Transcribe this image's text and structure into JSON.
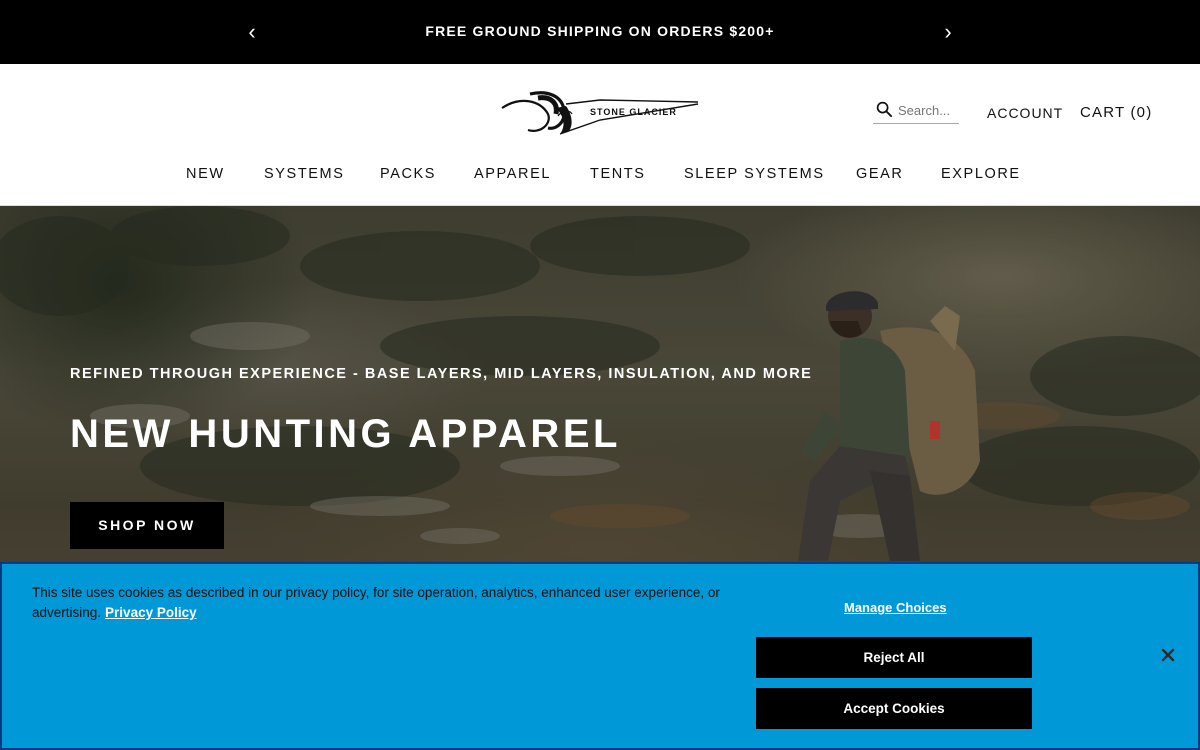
{
  "announcement": {
    "message": "FREE GROUND SHIPPING ON ORDERS $200+",
    "prev_arrow": "‹",
    "next_arrow": "›"
  },
  "header": {
    "logo_text": "STONE GLACIER",
    "search": {
      "placeholder": "Search..."
    },
    "account_label": "ACCOUNT",
    "cart_label": "CART (0)"
  },
  "nav": {
    "items": [
      {
        "label": "NEW"
      },
      {
        "label": "SYSTEMS"
      },
      {
        "label": "PACKS"
      },
      {
        "label": "APPAREL"
      },
      {
        "label": "TENTS"
      },
      {
        "label": "SLEEP SYSTEMS"
      },
      {
        "label": "GEAR"
      },
      {
        "label": "EXPLORE"
      }
    ]
  },
  "hero": {
    "subtitle": "REFINED THROUGH EXPERIENCE - BASE LAYERS, MID LAYERS, INSULATION, AND MORE",
    "title": "NEW HUNTING APPAREL",
    "cta_label": "SHOP NOW"
  },
  "cookie_banner": {
    "text": "This site uses cookies as described in our privacy policy, for site operation, analytics, enhanced user experience, or advertising.",
    "privacy_link": "Privacy Policy",
    "manage_label": "Manage Choices",
    "reject_label": "Reject All",
    "accept_label": "Accept Cookies",
    "background_color": "#0098d7"
  },
  "icons": {
    "search": "search-icon",
    "close": "close-icon",
    "logo": "ram-logo-icon"
  }
}
